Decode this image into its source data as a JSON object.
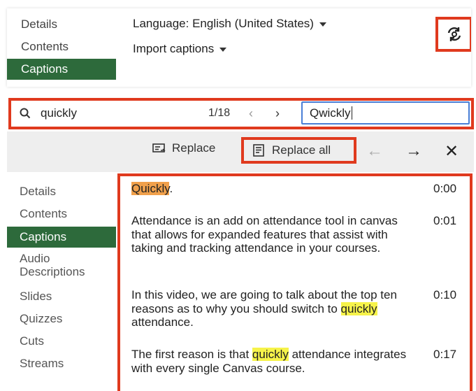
{
  "top_nav": {
    "items": [
      "Details",
      "Contents",
      "Captions"
    ],
    "active_index": 2
  },
  "language_label": "Language: English (United States)",
  "import_label": "Import captions",
  "find": {
    "query": "quickly",
    "count": "1/18",
    "replace_value": "Qwickly"
  },
  "toolbar": {
    "replace_label": "Replace",
    "replace_all_label": "Replace all"
  },
  "side_nav": {
    "items": [
      "Details",
      "Contents",
      "Captions",
      "Audio Descriptions",
      "Slides",
      "Quizzes",
      "Cuts",
      "Streams"
    ],
    "active_index": 2
  },
  "captions": [
    {
      "lines": [
        [
          "Quickly",
          "orange"
        ],
        [
          ".",
          ""
        ]
      ],
      "time": "0:00"
    },
    {
      "lines": [
        [
          "Attendance is an add on attendance tool in canvas that allows for expanded features that assist with taking and tracking attendance in your courses.",
          ""
        ]
      ],
      "time": "0:01"
    },
    {
      "lines": [
        [
          "In this video, we are going to talk about the top ten reasons as to why you should switch to ",
          ""
        ],
        [
          "quickly",
          "yellow"
        ],
        [
          " attendance.",
          ""
        ]
      ],
      "time": "0:10"
    },
    {
      "lines": [
        [
          "The first reason is that ",
          ""
        ],
        [
          "quickly",
          "yellow"
        ],
        [
          " attendance integrates with every single Canvas course.",
          ""
        ]
      ],
      "time": "0:17"
    }
  ],
  "colors": {
    "accent_green": "#2d6a3b",
    "highlight_red": "#e03a1e",
    "current_match": "#f0a04b",
    "other_match": "#f6f34a",
    "input_border": "#4a7fd6"
  }
}
